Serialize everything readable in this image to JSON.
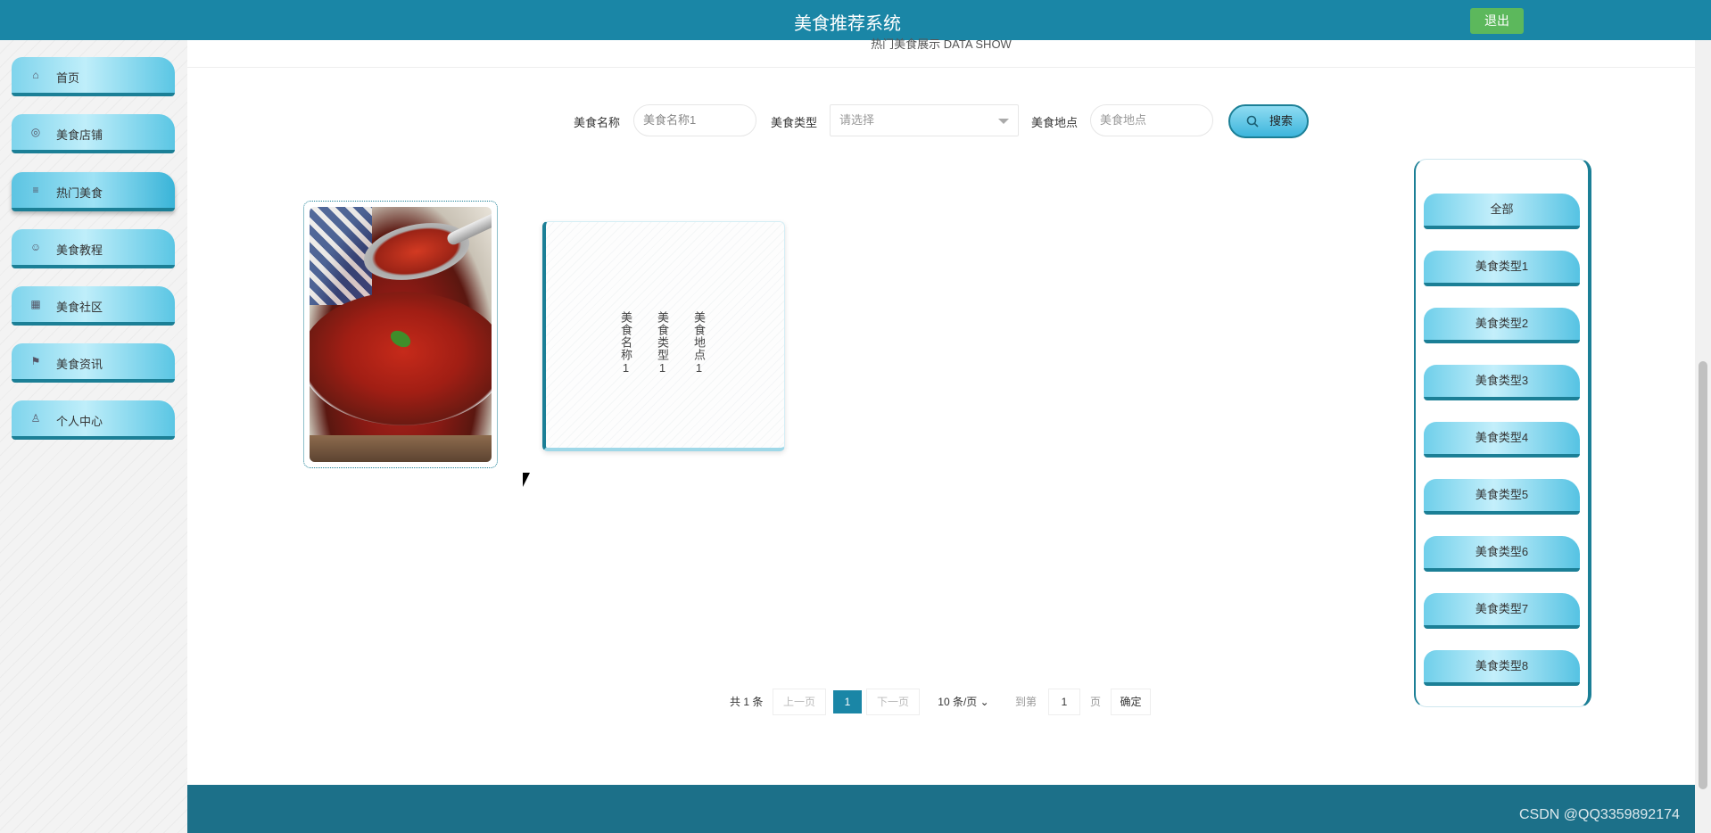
{
  "header": {
    "title": "美食推荐系统",
    "logout_label": "退出"
  },
  "sidebar": {
    "items": [
      {
        "label": "首页",
        "icon": "home-icon"
      },
      {
        "label": "美食店铺",
        "icon": "shop-icon"
      },
      {
        "label": "热门美食",
        "icon": "sliders-icon",
        "active": true
      },
      {
        "label": "美食教程",
        "icon": "smile-icon"
      },
      {
        "label": "美食社区",
        "icon": "grid-icon"
      },
      {
        "label": "美食资讯",
        "icon": "flag-icon"
      },
      {
        "label": "个人中心",
        "icon": "user-icon"
      }
    ]
  },
  "main": {
    "section_title": "热门美食展示 DATA SHOW",
    "search": {
      "name_label": "美食名称",
      "name_value": "美食名称1",
      "type_label": "美食类型",
      "type_placeholder": "请选择",
      "location_label": "美食地点",
      "location_placeholder": "美食地点",
      "button_label": "搜索"
    },
    "item": {
      "name": "美食名称1",
      "type": "美食类型1",
      "location": "美食地点1"
    },
    "categories": [
      "全部",
      "美食类型1",
      "美食类型2",
      "美食类型3",
      "美食类型4",
      "美食类型5",
      "美食类型6",
      "美食类型7",
      "美食类型8"
    ],
    "pagination": {
      "total": "共 1 条",
      "prev": "上一页",
      "current": "1",
      "next": "下一页",
      "page_size": "10 条/页",
      "goto_label": "到第",
      "goto_value": "1",
      "page_suffix": "页",
      "confirm": "确定"
    }
  },
  "watermark": "CSDN @QQ3359892174"
}
